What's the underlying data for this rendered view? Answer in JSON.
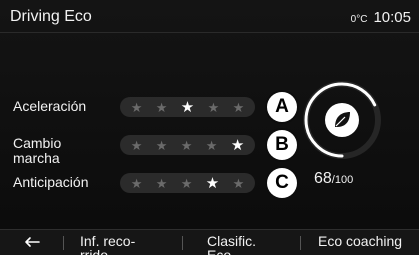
{
  "header": {
    "title": "Driving Eco",
    "temperature": "0°C",
    "time": "10:05"
  },
  "ratings": [
    {
      "label": "Aceleración",
      "marker": "A",
      "stars": 3,
      "max_stars": 5
    },
    {
      "label": "Cambio\nmarcha",
      "marker": "B",
      "stars": 5,
      "max_stars": 5
    },
    {
      "label": "Anticipación",
      "marker": "C",
      "stars": 4,
      "max_stars": 5
    }
  ],
  "score": {
    "value": "68",
    "max": "/100",
    "fraction": 0.68,
    "icon": "leaf-icon"
  },
  "nav": {
    "back_icon": "back-arrow-icon",
    "items": [
      {
        "label": "Inf. reco-\nrrido"
      },
      {
        "label": "Clasific.\nEco"
      },
      {
        "label": "Eco coaching"
      }
    ]
  },
  "colors": {
    "background": "#0d0d0d",
    "star_on": "#ffffff",
    "star_off": "#6b6b6b",
    "pill": "#2b2b2b"
  }
}
